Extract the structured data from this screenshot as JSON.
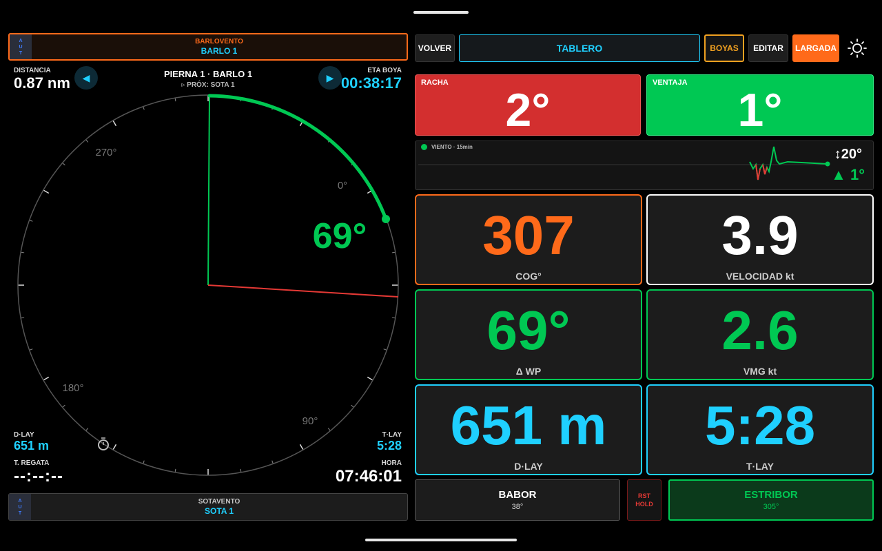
{
  "windward": {
    "aut_letters": [
      "A",
      "U",
      "T"
    ],
    "label": "BARLOVENTO",
    "value": "BARLO 1"
  },
  "leeward": {
    "aut_letters": [
      "A",
      "U",
      "T"
    ],
    "label": "SOTAVENTO",
    "value": "SOTA 1"
  },
  "nav": {
    "distance_label": "DISTANCIA",
    "distance_value": "0.87 nm",
    "leg_title": "PIERNA 1 · BARLO 1",
    "leg_next": "▹ PRÓX: SOTA 1",
    "eta_label": "ETA BOYA",
    "eta_value": "00:38:17",
    "prev_icon": "prev-triangle-icon",
    "next_icon": "next-triangle-icon"
  },
  "compass": {
    "heading_readout": "69°",
    "labels": [
      "270°",
      "0°",
      "180°",
      "90°"
    ],
    "colors": {
      "ring": "#555555",
      "arc": "#00c853",
      "green_line": "#00c853",
      "red_line": "#e53935",
      "label": "#777777"
    }
  },
  "bottom_left": {
    "dlay_label": "D·LAY",
    "dlay_value": "651 m",
    "race_label": "T. REGATA",
    "race_value": "--:--:--",
    "tlay_label": "T·LAY",
    "tlay_value": "5:28",
    "time_label": "HORA",
    "time_value": "07:46:01",
    "timer_icon": "stopwatch-icon"
  },
  "toolbar": {
    "volver": "VOLVER",
    "tablero": "TABLERO",
    "boyas": "BOYAS",
    "editar": "EDITAR",
    "largada": "LARGADA",
    "brightness_icon": "sun-icon"
  },
  "shifts": {
    "racha_label": "RACHA",
    "racha_value": "2°",
    "ventaja_label": "VENTAJA",
    "ventaja_value": "1°"
  },
  "wind": {
    "label": "VIENTO · 15min",
    "range": "↕20°",
    "delta": "▲ 1°"
  },
  "tiles": [
    {
      "value": "307",
      "label": "COG°",
      "color": "#ff6a1a",
      "border": "#ff6a1a"
    },
    {
      "value": "3.9",
      "label": "VELOCIDAD kt",
      "color": "#ffffff",
      "border": "#ffffff"
    },
    {
      "value": "69°",
      "label": "Δ WP",
      "color": "#00c853",
      "border": "#00c853"
    },
    {
      "value": "2.6",
      "label": "VMG kt",
      "color": "#00c853",
      "border": "#00c853"
    },
    {
      "value": "651 m",
      "label": "D·LAY",
      "color": "#1fd0ff",
      "border": "#1fd0ff"
    },
    {
      "value": "5:28",
      "label": "T·LAY",
      "color": "#1fd0ff",
      "border": "#1fd0ff"
    }
  ],
  "tack": {
    "babor_label": "BABOR",
    "babor_value": "38°",
    "rst_line1": "RST",
    "rst_line2": "HOLD",
    "estribor_label": "ESTRIBOR",
    "estribor_value": "305°"
  }
}
